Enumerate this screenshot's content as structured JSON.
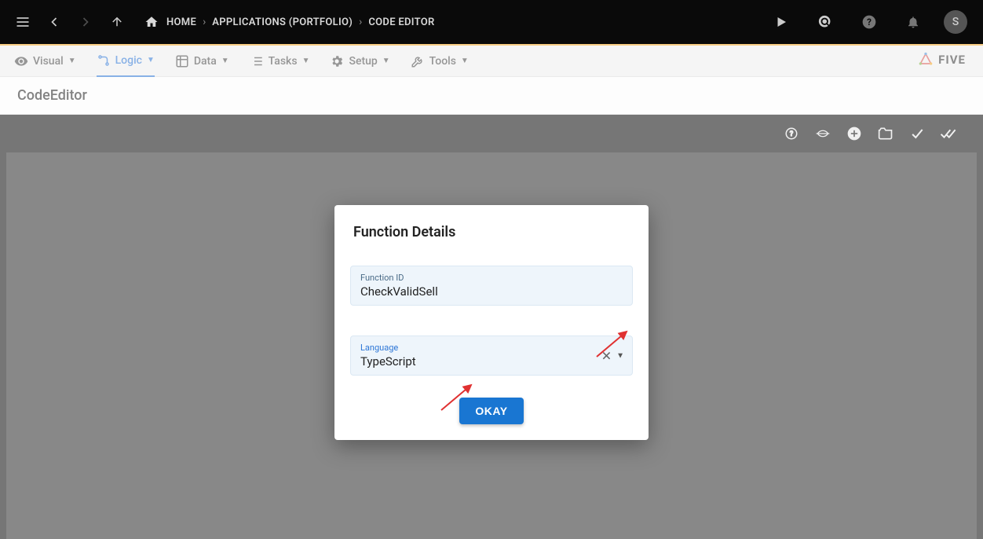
{
  "topbar": {
    "home": "HOME",
    "crumb1": "APPLICATIONS (PORTFOLIO)",
    "crumb2": "CODE EDITOR",
    "avatar_initial": "S"
  },
  "menubar": {
    "visual": "Visual",
    "logic": "Logic",
    "data": "Data",
    "tasks": "Tasks",
    "setup": "Setup",
    "tools": "Tools",
    "brand": "FIVE"
  },
  "page": {
    "title": "CodeEditor"
  },
  "modal": {
    "title": "Function Details",
    "function_id_label": "Function ID",
    "function_id_value": "CheckValidSell",
    "language_label": "Language",
    "language_value": "TypeScript",
    "okay": "OKAY"
  }
}
